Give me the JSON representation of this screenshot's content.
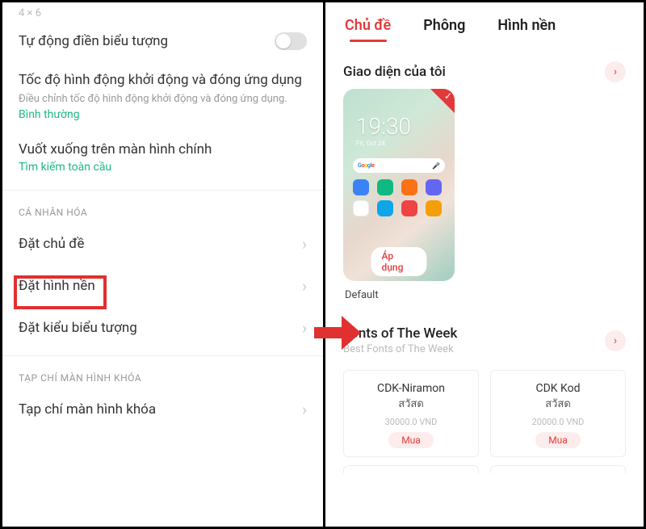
{
  "left": {
    "faded_top": "4 × 6",
    "auto_fill_icons": "Tự động điền biểu tượng",
    "animation": {
      "title": "Tốc độ hình động khởi động và đóng ứng dụng",
      "desc": "Điều chỉnh tốc độ hình động khởi động và đóng ứng dụng.",
      "value": "Bình thường"
    },
    "swipe_down": {
      "title": "Vuốt xuống trên màn hình chính",
      "value": "Tìm kiếm toàn cầu"
    },
    "section_personalize": "CÁ NHÂN HÓA",
    "set_theme": "Đặt chủ đề",
    "set_wallpaper": "Đặt hình nền",
    "set_icon_style": "Đặt kiểu biểu tượng",
    "section_lockscreen": "TẠP CHÍ MÀN HÌNH KHÓA",
    "lock_magazine": "Tạp chí màn hình khóa"
  },
  "right": {
    "tabs": {
      "theme": "Chủ đề",
      "font": "Phông",
      "wallpaper": "Hình nền"
    },
    "my_interface": "Giao diện của tôi",
    "theme_preview": {
      "time": "19:30",
      "date_line": "Fri, Oct 24",
      "apply": "Áp dụng"
    },
    "theme_name": "Default",
    "fonts_section": {
      "title": "Fonts of The Week",
      "subtitle": "Best Fonts of The Week"
    },
    "fonts": [
      {
        "name": "CDK-Niramon",
        "script": "สวัสด",
        "price": "30000.0 VND",
        "buy": "Mua"
      },
      {
        "name": "CDK Kod",
        "script": "สวัสด",
        "price": "20000.0 VND",
        "buy": "Mua"
      }
    ]
  }
}
